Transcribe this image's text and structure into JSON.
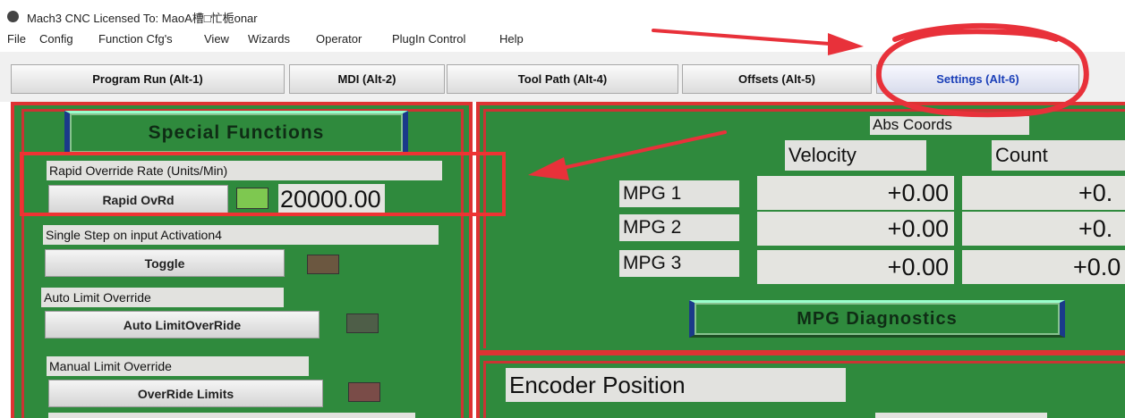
{
  "window": {
    "title": "Mach3 CNC  Licensed To: MaoA槽□忙栀onar"
  },
  "menu": [
    "File",
    "Config",
    "Function Cfg's",
    "View",
    "Wizards",
    "Operator",
    "PlugIn Control",
    "Help"
  ],
  "tabs": [
    {
      "label": "Program Run (Alt-1)",
      "active": false
    },
    {
      "label": "MDI (Alt-2)",
      "active": false
    },
    {
      "label": "Tool Path (Alt-4)",
      "active": false
    },
    {
      "label": "Offsets (Alt-5)",
      "active": false
    },
    {
      "label": "Settings (Alt-6)",
      "active": true
    }
  ],
  "special_functions": {
    "title": "Special Functions",
    "rapid_override": {
      "label": "Rapid Override Rate (Units/Min)",
      "button": "Rapid OvRd",
      "value": "20000.00",
      "led_color": "#7ec850"
    },
    "single_step": {
      "label": "Single Step on input Activation4",
      "button": "Toggle",
      "led_color": "#6b5740"
    },
    "auto_limit": {
      "label": "Auto Limit Override",
      "button": "Auto LimitOverRide",
      "led_color": "#4e5e48"
    },
    "manual_limit": {
      "label": "Manual Limit Override",
      "button": "OverRide Limits",
      "led_color": "#7a4c48"
    }
  },
  "mpg": {
    "coords_label": "Abs Coords",
    "velocity_header": "Velocity",
    "count_header": "Count",
    "rows": [
      {
        "label": "MPG 1",
        "velocity": "+0.00",
        "count": "+0."
      },
      {
        "label": "MPG 2",
        "velocity": "+0.00",
        "count": "+0."
      },
      {
        "label": "MPG 3",
        "velocity": "+0.00",
        "count": "+0.0"
      }
    ],
    "diagnostics_title": "MPG Diagnostics"
  },
  "encoder": {
    "title": "Encoder Position"
  },
  "colors": {
    "panel_green": "#2f8a3d",
    "panel_border_red": "#d33",
    "annotation_red": "#e33",
    "active_tab_blue": "#1a3fb8"
  }
}
